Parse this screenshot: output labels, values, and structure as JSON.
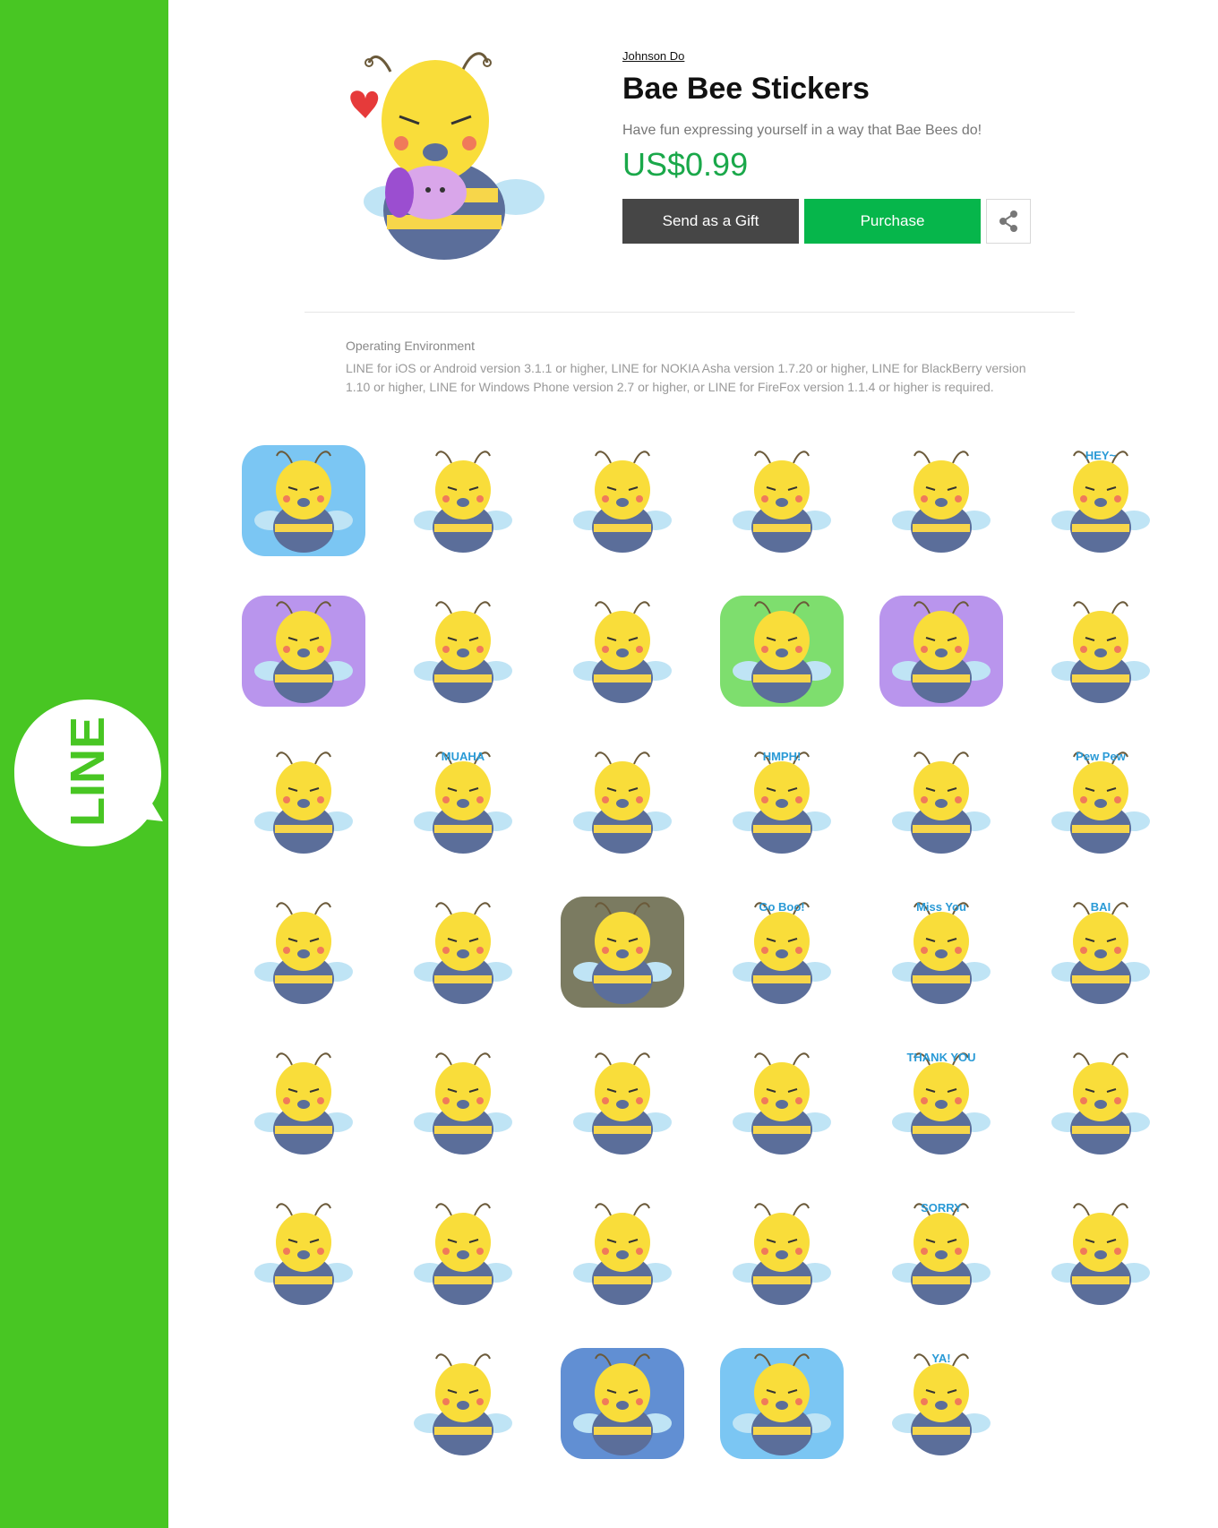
{
  "brand": {
    "name": "LINE",
    "color": "#48c623"
  },
  "product": {
    "author": "Johnson Do",
    "title": "Bae Bee Stickers",
    "description": "Have fun expressing yourself in a way that Bae Bees do!",
    "price": "US$0.99",
    "gift_label": "Send as a Gift",
    "purchase_label": "Purchase",
    "share_icon": "share-icon"
  },
  "environment": {
    "heading": "Operating Environment",
    "text": "LINE for iOS or Android version 3.1.1 or higher, LINE for NOKIA Asha version 1.7.20 or higher, LINE for BlackBerry version 1.10 or higher, LINE for Windows Phone version 2.7 or higher, or LINE for FireFox version 1.1.4 or higher is required."
  },
  "stickers": [
    {
      "bg": "#5ab8f0",
      "text": ""
    },
    {
      "bg": "",
      "text": ""
    },
    {
      "bg": "",
      "text": ""
    },
    {
      "bg": "",
      "text": ""
    },
    {
      "bg": "",
      "text": ""
    },
    {
      "bg": "",
      "text": "HEY~"
    },
    {
      "bg": "#a77ae8",
      "text": ""
    },
    {
      "bg": "",
      "text": ""
    },
    {
      "bg": "",
      "text": ""
    },
    {
      "bg": "#5ed64a",
      "text": ""
    },
    {
      "bg": "#a77ae8",
      "text": ""
    },
    {
      "bg": "",
      "text": ""
    },
    {
      "bg": "",
      "text": ""
    },
    {
      "bg": "",
      "text": "MUAHA"
    },
    {
      "bg": "",
      "text": ""
    },
    {
      "bg": "",
      "text": "HMPH!"
    },
    {
      "bg": "",
      "text": ""
    },
    {
      "bg": "",
      "text": "Pew Pew"
    },
    {
      "bg": "",
      "text": ""
    },
    {
      "bg": "",
      "text": ""
    },
    {
      "bg": "#5a5a3a",
      "text": ""
    },
    {
      "bg": "",
      "text": "Go Boo!"
    },
    {
      "bg": "",
      "text": "Miss You"
    },
    {
      "bg": "",
      "text": "BAI"
    },
    {
      "bg": "",
      "text": ""
    },
    {
      "bg": "",
      "text": ""
    },
    {
      "bg": "",
      "text": ""
    },
    {
      "bg": "",
      "text": ""
    },
    {
      "bg": "",
      "text": "THANK YOU"
    },
    {
      "bg": "",
      "text": ""
    },
    {
      "bg": "",
      "text": ""
    },
    {
      "bg": "",
      "text": ""
    },
    {
      "bg": "",
      "text": ""
    },
    {
      "bg": "",
      "text": ""
    },
    {
      "bg": "",
      "text": "SORRY"
    },
    {
      "bg": "",
      "text": ""
    },
    {
      "bg": "",
      "text": ""
    },
    {
      "bg": "#3a73c8",
      "text": ""
    },
    {
      "bg": "#5ab8f0",
      "text": ""
    },
    {
      "bg": "",
      "text": "YA!"
    }
  ]
}
